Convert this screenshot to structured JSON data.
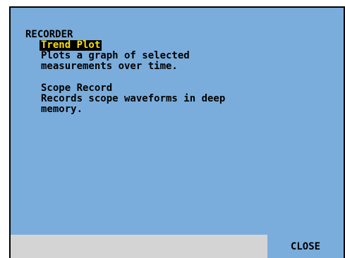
{
  "menu": {
    "title": "RECORDER",
    "items": [
      {
        "label": "Trend Plot",
        "selected": true,
        "description": "Plots a graph of selected\nmeasurements over time."
      },
      {
        "label": "Scope Record",
        "selected": false,
        "description": "Records scope waveforms in deep\nmemory."
      }
    ]
  },
  "softkeys": {
    "f1": "",
    "f2": "",
    "f3": "",
    "f4": "",
    "f5": "CLOSE"
  },
  "colors": {
    "screen_background": "#7aaddc",
    "highlight_background": "#000000",
    "highlight_text": "#ffdf00",
    "softkey_inactive": "#d4d4d4"
  }
}
